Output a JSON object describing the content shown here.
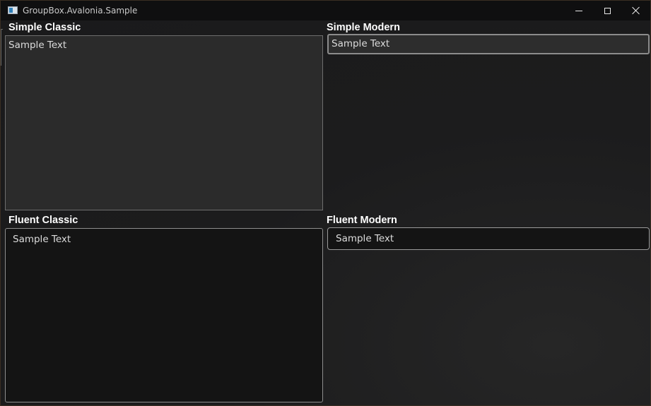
{
  "window": {
    "title": "GroupBox.Avalonia.Sample"
  },
  "groups": {
    "simple_classic": {
      "header": "Simple Classic",
      "content": "Sample Text"
    },
    "simple_modern": {
      "header": "Simple Modern",
      "content": "Sample Text"
    },
    "fluent_classic": {
      "header": "Fluent Classic",
      "content": "Sample Text"
    },
    "fluent_modern": {
      "header": "Fluent Modern",
      "content": "Sample Text"
    }
  },
  "icons": {
    "app": "window-app-icon",
    "minimize": "minimize-icon",
    "maximize": "maximize-icon",
    "close": "close-icon"
  },
  "colors": {
    "titlebar": "#0f0f10",
    "background": "#1c1c1d",
    "classic_fill": "#2b2b2b",
    "fluent_fill": "#141414",
    "header_text": "#ffffff"
  }
}
